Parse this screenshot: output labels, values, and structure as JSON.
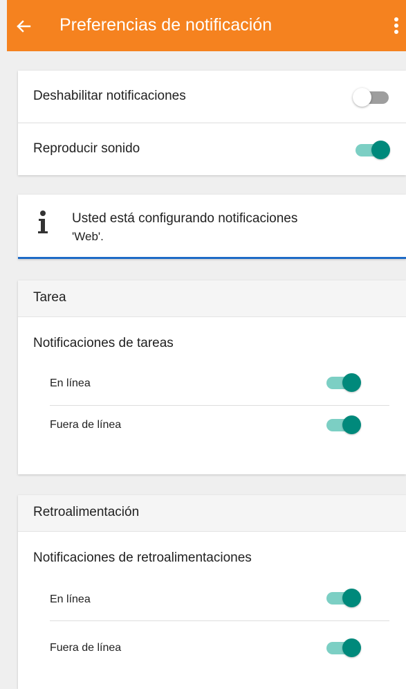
{
  "appbar": {
    "title": "Preferencias de notificación",
    "back_icon": "arrow-left-icon",
    "menu_icon": "more-vert-icon",
    "color": "#f5821f"
  },
  "general": {
    "disable": {
      "label": "Deshabilitar notificaciones",
      "on": false
    },
    "sound": {
      "label": "Reproducir sonido",
      "on": true
    }
  },
  "info": {
    "icon": "info-icon",
    "text_line1": "Usted está configurando notificaciones",
    "text_line2": "'Web'.",
    "accent": "#1e6bc6"
  },
  "sections": [
    {
      "title": "Tarea",
      "group_label": "Notificaciones de tareas",
      "items": [
        {
          "label": "En línea",
          "on": true
        },
        {
          "label": "Fuera de línea",
          "on": true
        }
      ]
    },
    {
      "title": "Retroalimentación",
      "group_label": "Notificaciones de retroalimentaciones",
      "items": [
        {
          "label": "En línea",
          "on": true
        },
        {
          "label": "Fuera de línea",
          "on": true
        }
      ]
    }
  ],
  "colors": {
    "toggle_on": "#00897b",
    "toggle_on_track": "#7ccfc4"
  }
}
